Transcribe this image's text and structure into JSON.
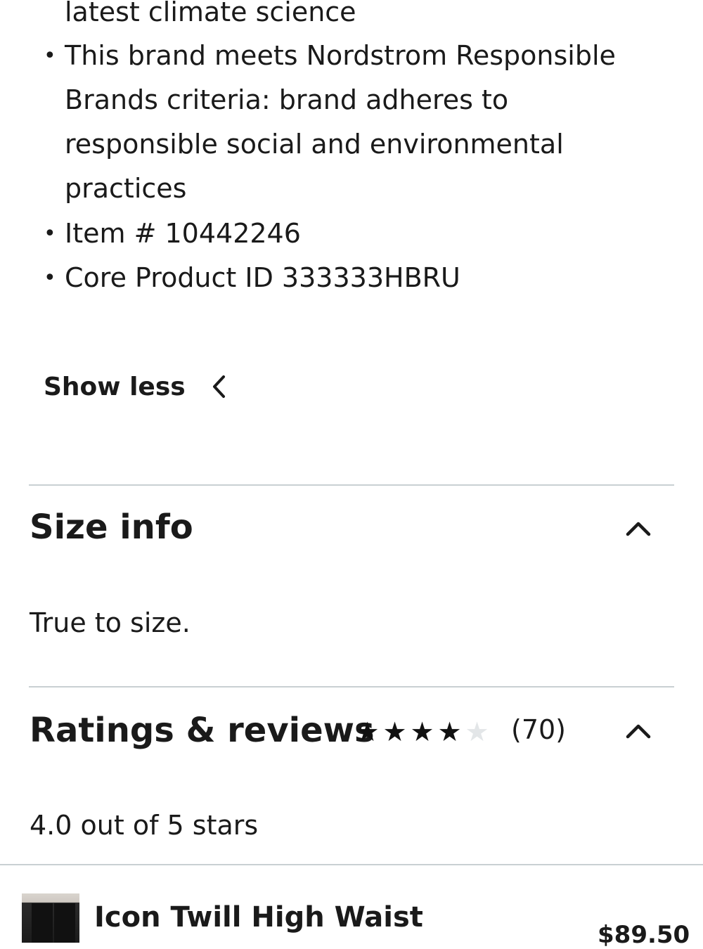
{
  "details": {
    "items": [
      "latest climate science",
      "This brand meets Nordstrom Responsible Brands criteria: brand adheres to responsible social and environmental practices",
      "Item # 10442246",
      "Core Product ID 333333HBRU"
    ],
    "show_less_label": "Show less"
  },
  "size_info": {
    "title": "Size info",
    "text": "True to size."
  },
  "ratings": {
    "title": "Ratings & reviews",
    "rating_value": 4,
    "rating_max": 5,
    "count_text": "(70)",
    "summary": "4.0 out of 5 stars"
  },
  "product": {
    "name": "Icon Twill High Waist",
    "price": "$89.50"
  },
  "icons": {
    "show_less": "chevron-left-icon",
    "collapse": "chevron-up-icon",
    "star": "star-icon"
  },
  "colors": {
    "text": "#1a1a1a",
    "divider": "#c9d0d3",
    "star_filled": "#111111",
    "star_empty": "#e3e6e8"
  }
}
